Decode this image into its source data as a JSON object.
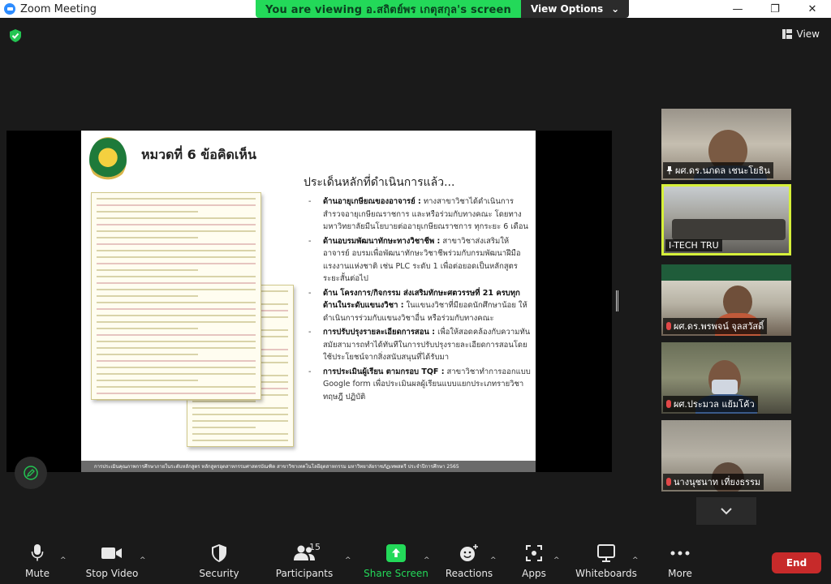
{
  "window": {
    "title": "Zoom Meeting",
    "minimize": "—",
    "maximize": "❐",
    "close": "✕"
  },
  "banner": {
    "text": "You are viewing อ.สถิตย์พร เกตุสกุล's screen",
    "options_label": "View Options",
    "options_caret": "⌄"
  },
  "top_right": {
    "view_label": "View"
  },
  "slide": {
    "title": "หมวดที่ 6 ข้อคิดเห็น",
    "heading": "ประเด็นหลักที่ดำเนินการแล้ว...",
    "bullets": [
      {
        "bold": "ด้านอายุเกษียณของอาจารย์ :",
        "text": " ทางสาขาวิชาได้ดำเนินการสำรวจอายุเกษียณราชการ และหรือร่วมกับทางคณะ โดยทางมหาวิทยาลัยมีนโยบายต่ออายุเกษียณราชการ ทุกระยะ 6 เดือน"
      },
      {
        "bold": "ด้านอบรมพัฒนาทักษะทางวิชาชีพ :",
        "text": " สาขาวิชาส่งเสริมให้อาจารย์ อบรมเพื่อพัฒนาทักษะวิชาชีพร่วมกับกรมพัฒนาฝีมือแรงงานแห่งชาติ เช่น PLC ระดับ 1 เพื่อต่อยอดเป็นหลักสูตรระยะสั้นต่อไป"
      },
      {
        "bold": "ด้าน โครงการ/กิจกรรม ส่งเสริมทักษะศตวรรษที่ 21 ครบทุกด้านในระดับแขนงวิชา :",
        "text": " ในแขนงวิชาที่มียอดนักศึกษาน้อย ให้ดำเนินการร่วมกับแขนงวิชาอื่น หรือร่วมกับทางคณะ"
      },
      {
        "bold": "การปรับปรุงรายละเอียดการสอน :",
        "text": " เพื่อให้สอดคล้องกับความทันสมัยสามารถทำได้ทันทีในการปรับปรุงรายละเอียดการสอนโดยใช้ประโยชน์จากสิ่งสนับสนุนที่ได้รับมา"
      },
      {
        "bold": "การประเมินผู้เรียน ตามกรอบ TQF :",
        "text": " สาขาวิชาทำการออกแบบ Google form เพื่อประเมินผลผู้เรียนแบบแยกประเภทรายวิชา ทฤษฎี ปฏิบัติ"
      }
    ],
    "footer": "การประเมินคุณภาพการศึกษาภายในระดับหลักสูตร หลักสูตรอุตสาหกรรมศาสตรบัณฑิต สาขาวิชาเทคโนโลยีอุตสาหกรรม มหาวิทยาลัยราชภัฏเทพสตรี ประจำปีการศึกษา 2565"
  },
  "participants": [
    {
      "name": "ผศ.ดร.นภดล เชนะโยธิน",
      "pinned": true,
      "muted": false
    },
    {
      "name": "I-TECH TRU",
      "pinned": false,
      "muted": false,
      "active": true
    },
    {
      "name": "ผศ.ดร.พรพจน์ จุลสวัสดิ์",
      "pinned": false,
      "muted": true
    },
    {
      "name": "ผศ.ประมวล แย้มโค้ว",
      "pinned": false,
      "muted": true
    },
    {
      "name": "นางนุชนาท เที่ยงธรรม",
      "pinned": false,
      "muted": true
    }
  ],
  "toolbar": {
    "mute": "Mute",
    "stop_video": "Stop Video",
    "security": "Security",
    "participants": "Participants",
    "participants_count": "15",
    "share_screen": "Share Screen",
    "reactions": "Reactions",
    "apps": "Apps",
    "whiteboards": "Whiteboards",
    "more": "More",
    "end": "End",
    "caret": "^"
  },
  "colors": {
    "banner_green": "#23d959",
    "share_green": "#23d959",
    "end_red": "#c72a2a",
    "active_border": "#d6f03a"
  }
}
